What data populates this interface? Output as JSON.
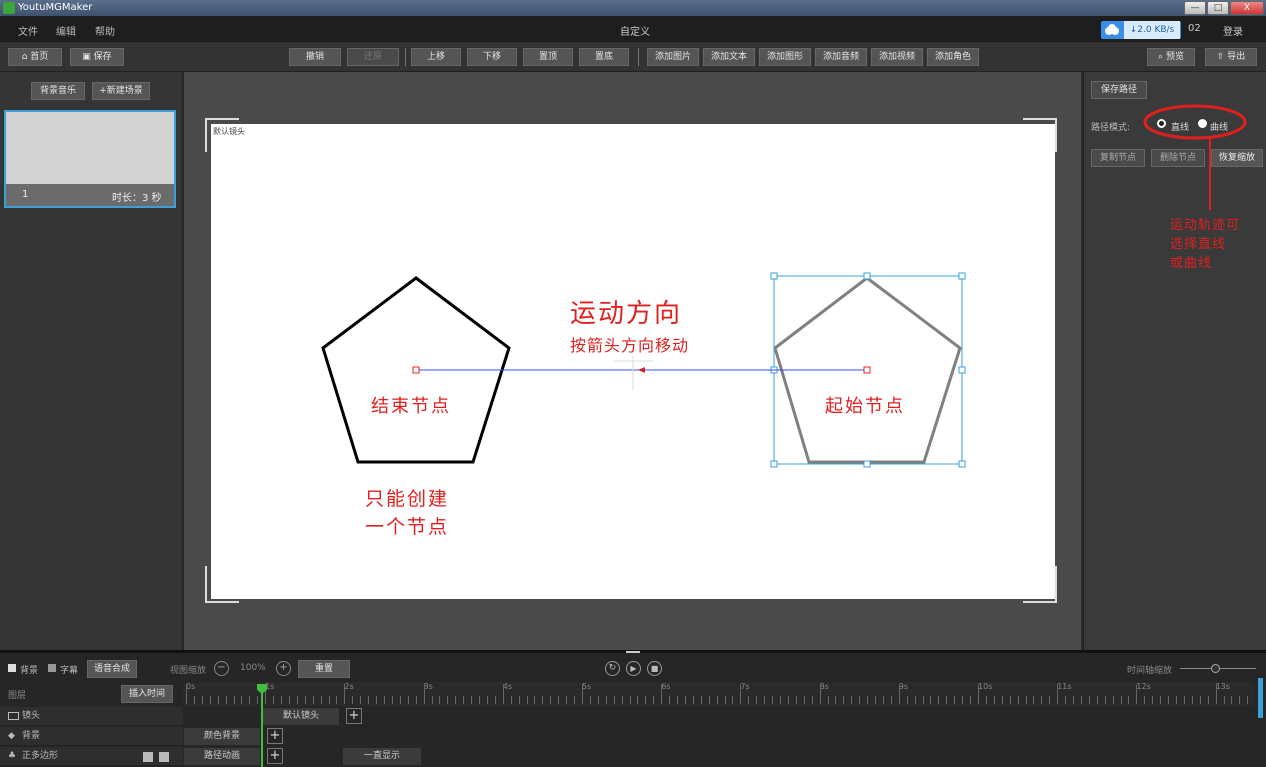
{
  "window": {
    "title": "YoutuMGMaker",
    "doc_title": "自定义",
    "min": "—",
    "max": "□",
    "close": "X"
  },
  "menu": [
    "文件",
    "编辑",
    "帮助"
  ],
  "header_right": {
    "speed": "↓2.0 KB/s",
    "user": "02",
    "login": "登录"
  },
  "toolbar": {
    "home": "首页",
    "save": "保存",
    "undo": "撤销",
    "redo": "还原",
    "move_up": "上移",
    "move_down": "下移",
    "to_top": "置顶",
    "to_bottom": "置底",
    "add_image": "添加图片",
    "add_text": "添加文本",
    "add_shape": "添加图形",
    "add_audio": "添加音频",
    "add_video": "添加视频",
    "add_role": "添加角色",
    "preview": "预览",
    "export": "导出"
  },
  "left": {
    "bg_music": "背景音乐",
    "new_scene": "+新建场景",
    "scene_index": "1",
    "scene_duration": "时长：3 秒"
  },
  "stage": {
    "camera_label": "默认镜头",
    "end_node": "结束节点",
    "start_node": "起始节点",
    "motion_title": "运动方向",
    "motion_sub": "按箭头方向移动",
    "single_node_line1": "只能创建",
    "single_node_line2": "一个节点"
  },
  "right": {
    "save_path": "保存路径",
    "path_mode_label": "路径模式:",
    "mode_line": "直线",
    "mode_curve": "曲线",
    "copy_node": "复制节点",
    "delete_node": "删除节点",
    "restore_zoom": "恢复缩放",
    "annotation_line1": "运动轨迹可",
    "annotation_line2": "选择直线",
    "annotation_line3": "或曲线"
  },
  "timeline": {
    "bg_check": "背景",
    "subtitle_check": "字幕",
    "tts": "语音合成",
    "zoom_label": "视图缩放",
    "zoom_value": "100%",
    "reset": "重置",
    "timeline_zoom": "时间轴缩放",
    "layers_label": "图层",
    "insert_time": "插入时间",
    "ticks": [
      "0s",
      "1s",
      "2s",
      "3s",
      "4s",
      "5s",
      "6s",
      "7s",
      "8s",
      "9s",
      "10s",
      "11s",
      "12s",
      "13s"
    ],
    "rows": [
      {
        "label": "镜头",
        "clip": "默认镜头"
      },
      {
        "label": "背景",
        "clip": "颜色背景"
      },
      {
        "label": "正多边形",
        "clip": "路径动画",
        "extra": "一直显示"
      }
    ]
  },
  "colors": {
    "accent": "#3aa0d8",
    "annotation": "#e02020",
    "path_line": "#3050ff"
  }
}
